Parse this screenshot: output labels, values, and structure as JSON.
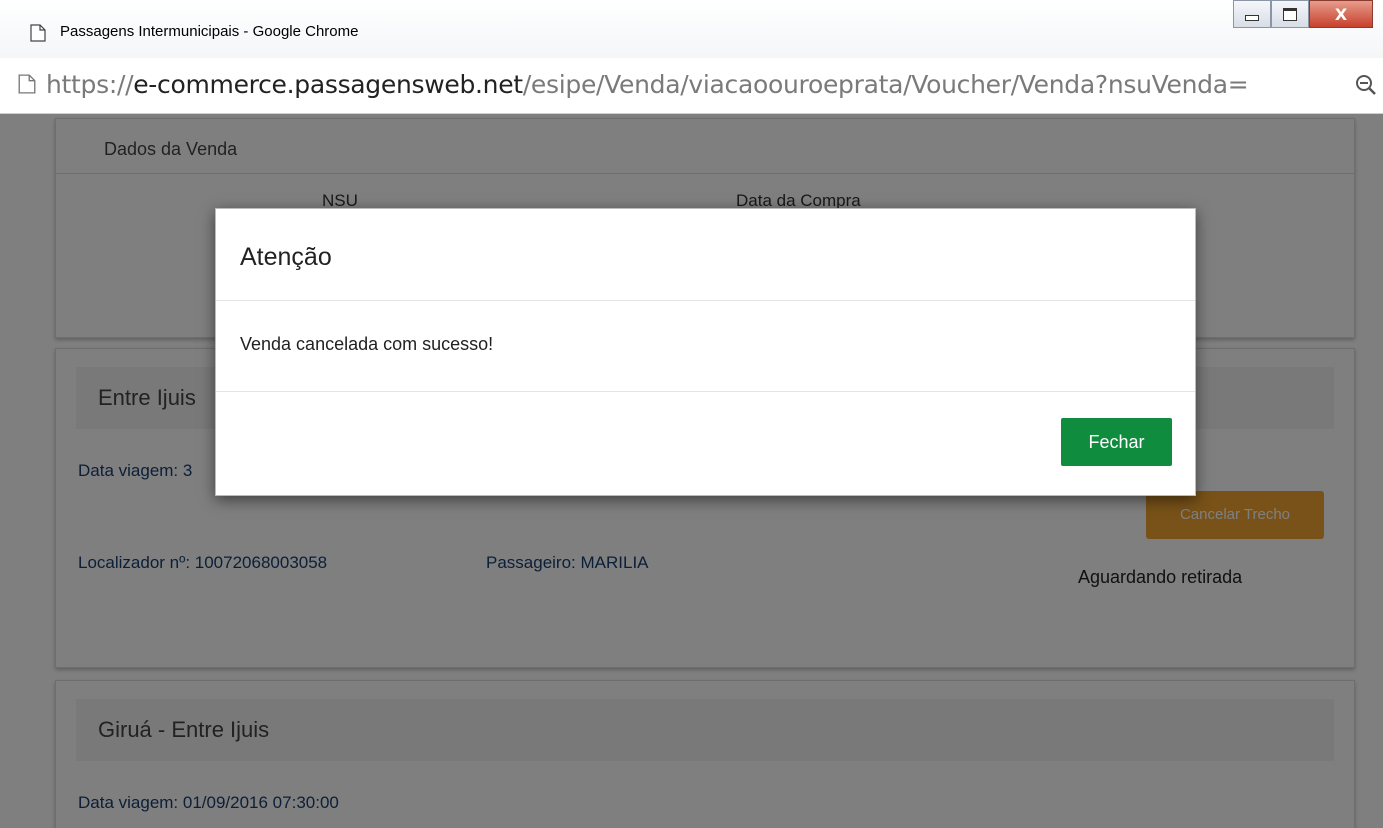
{
  "window": {
    "title": "Passagens Intermunicipais - Google Chrome",
    "minimize_icon": "minimize-icon",
    "maximize_icon": "maximize-icon",
    "close_glyph": "X"
  },
  "address_bar": {
    "url_scheme": "https://",
    "url_domain": "e-commerce.passagensweb.net",
    "url_path": "/esipe/Venda/viacaoouroeprata/Voucher/Venda?nsuVenda="
  },
  "sale_panel": {
    "heading": "Dados da Venda",
    "col_nsu": "NSU",
    "col_date": "Data da Compra"
  },
  "trip1": {
    "heading": "Entre Ijuis",
    "date_label": "Data viagem: 3",
    "locator_label": "Localizador nº: 10072068003058",
    "passenger_label": "Passageiro: MARILIA",
    "cancel_button": "Cancelar Trecho",
    "status": "Aguardando retirada"
  },
  "trip2": {
    "heading": "Giruá - Entre Ijuis",
    "date_label": "Data viagem: 01/09/2016 07:30:00"
  },
  "modal": {
    "title": "Atenção",
    "message": "Venda cancelada com sucesso!",
    "close_button": "Fechar"
  },
  "colors": {
    "primary_green": "#108c3f",
    "orange": "#f0a531",
    "label_blue": "#1a3f6e"
  }
}
